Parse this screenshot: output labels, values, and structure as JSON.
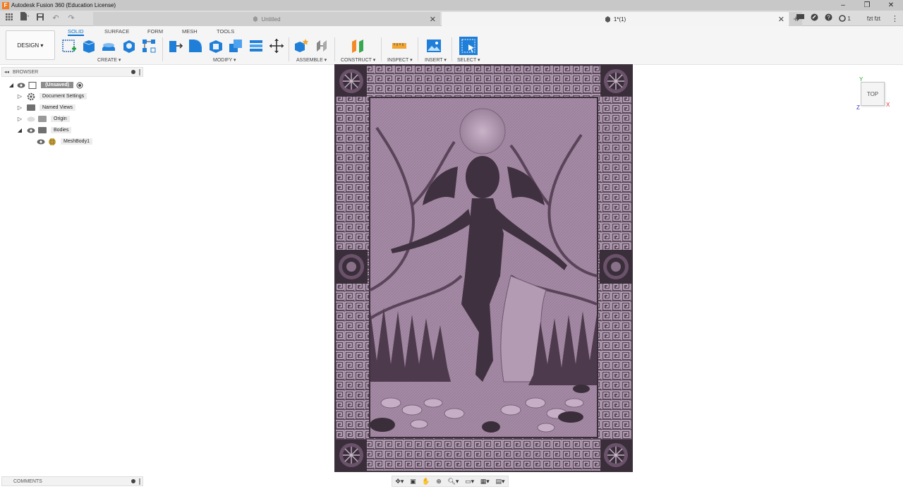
{
  "window": {
    "title": "Autodesk Fusion 360 (Education License)",
    "controls": [
      "–",
      "❐",
      "✕"
    ]
  },
  "tabs": {
    "inactive_doc": "Untitled",
    "active_doc": "1*(1)",
    "close_glyph": "✕",
    "add_glyph": "+",
    "jobs_count": "1",
    "user": "fzt fzt"
  },
  "toolbar": {
    "workspace": "DESIGN ▾",
    "tabs": [
      "SOLID",
      "SURFACE",
      "FORM",
      "MESH",
      "TOOLS"
    ],
    "active_tab": "SOLID",
    "groups": {
      "create": "CREATE ▾",
      "modify": "MODIFY ▾",
      "assemble": "ASSEMBLE ▾",
      "construct": "CONSTRUCT ▾",
      "inspect": "INSPECT ▾",
      "insert": "INSERT ▾",
      "select": "SELECT ▾"
    }
  },
  "browser": {
    "title": "BROWSER",
    "items": [
      {
        "label": "(Unsaved)"
      },
      {
        "label": "Document Settings"
      },
      {
        "label": "Named Views"
      },
      {
        "label": "Origin"
      },
      {
        "label": "Bodies"
      },
      {
        "label": "MeshBody1"
      }
    ]
  },
  "comments": {
    "title": "COMMENTS"
  },
  "viewcube": {
    "face": "TOP",
    "x": "X",
    "y": "Y",
    "z": "Z"
  },
  "colors": {
    "accent": "#0a6fc7",
    "mesh_tint": "#8c6f8c",
    "frame_dark": "#3b2e3b"
  },
  "icons": {
    "file": "file-icon",
    "save": "save-icon",
    "undo": "undo-icon",
    "redo": "redo-icon",
    "grid": "app-grid-icon"
  }
}
